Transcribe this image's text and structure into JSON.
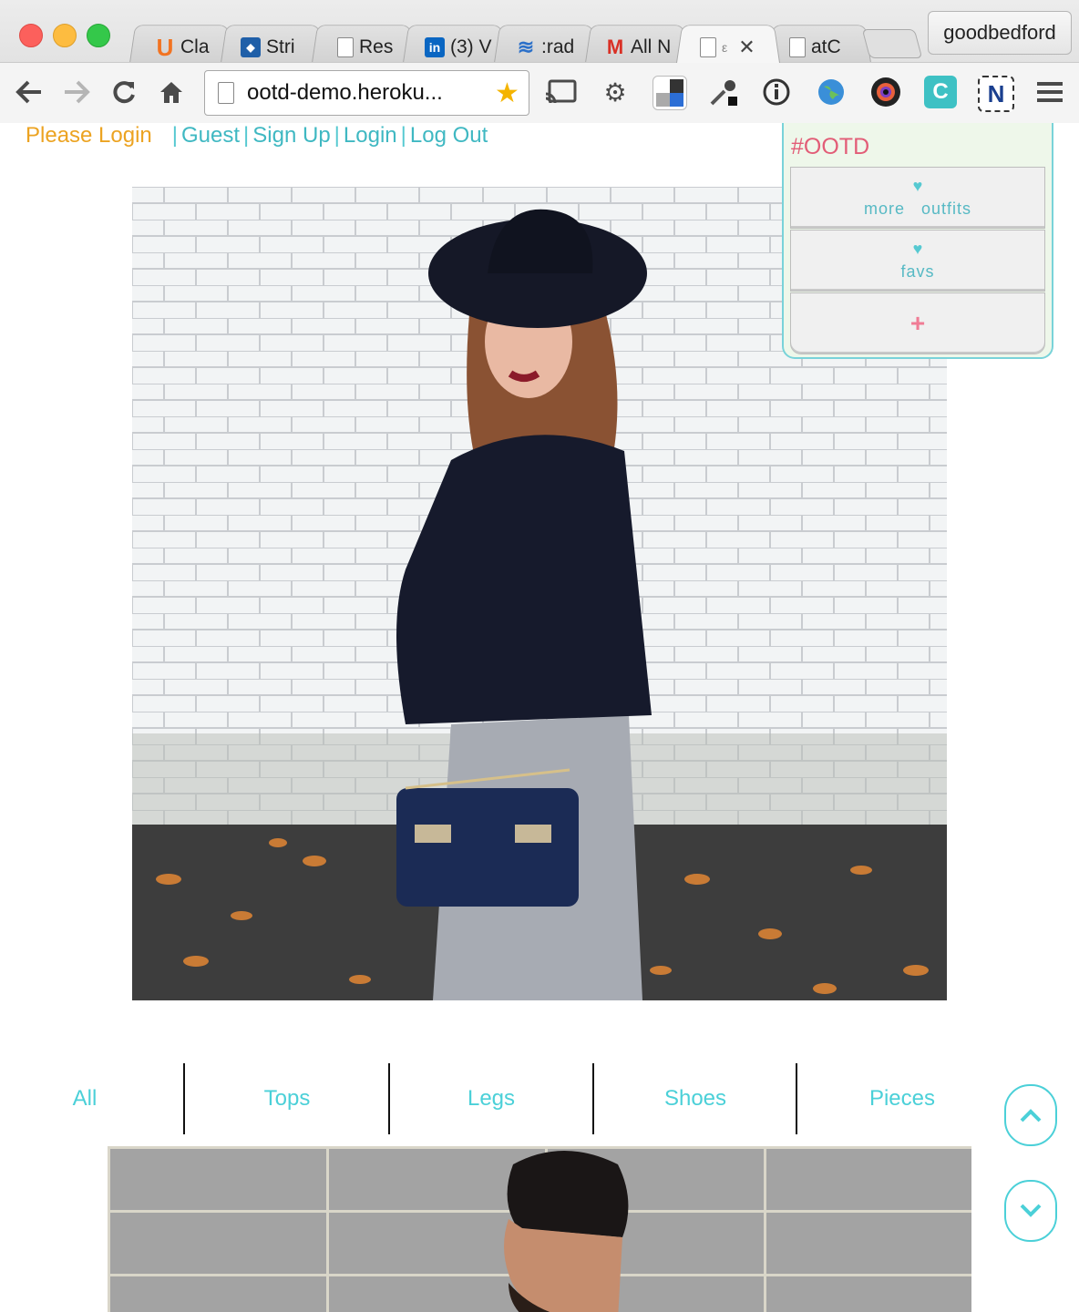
{
  "browser": {
    "tabs": [
      {
        "icon": "udemy-icon",
        "label": "Cla"
      },
      {
        "icon": "stripe-icon",
        "label": "Stri"
      },
      {
        "icon": "document-icon",
        "label": "Res"
      },
      {
        "icon": "linkedin-icon",
        "label": "(3) V"
      },
      {
        "icon": "wave-icon",
        "label": ":rad"
      },
      {
        "icon": "gmail-icon",
        "label": "All N"
      },
      {
        "icon": "document-icon",
        "label": "ε",
        "active": true
      },
      {
        "icon": "document-icon",
        "label": "atC"
      }
    ],
    "profile": "goodbedford",
    "url": "ootd-demo.heroku..."
  },
  "auth": {
    "status": "Please Login",
    "links": [
      "Guest",
      "Sign Up",
      "Login",
      "Log Out"
    ]
  },
  "sidebar": {
    "title": "#OOTD",
    "more_outfits": "more   outfits",
    "favs": "favs",
    "add": "+"
  },
  "filters": [
    "All",
    "Tops",
    "Legs",
    "Shoes",
    "Pieces"
  ],
  "colors": {
    "accent": "#4bd0d8",
    "login_prompt": "#eca321",
    "brand_pink": "#e25d77"
  }
}
